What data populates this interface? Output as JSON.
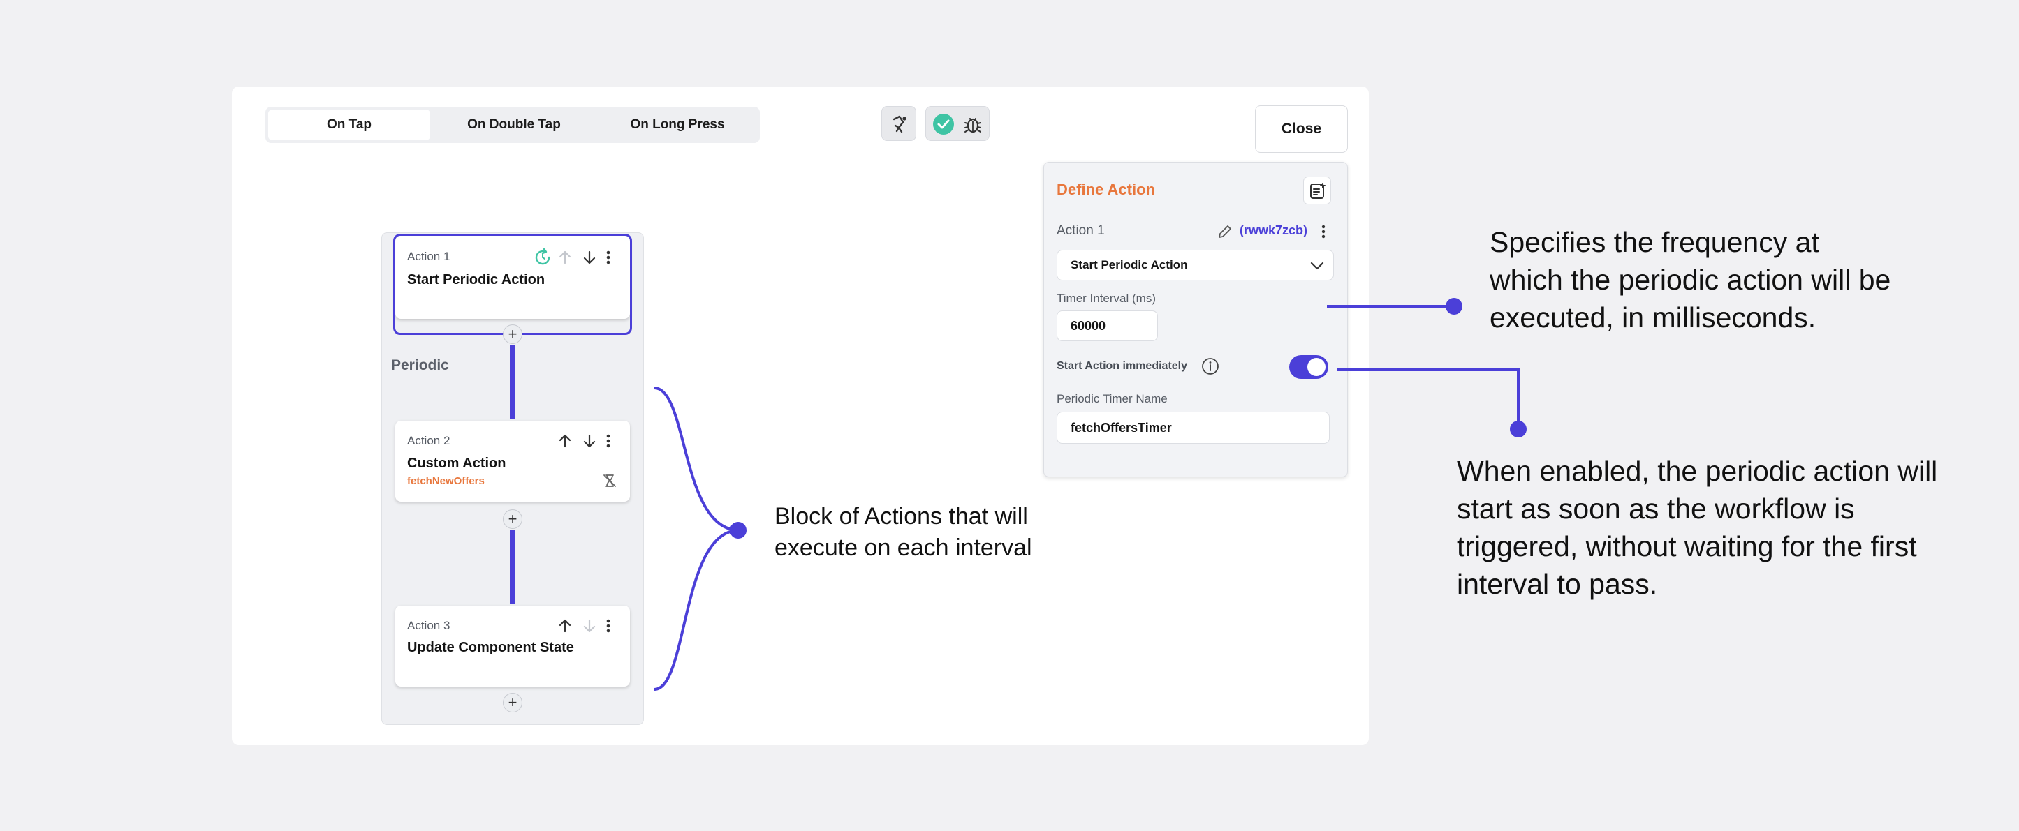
{
  "tabs": [
    "On Tap",
    "On Double Tap",
    "On Long Press"
  ],
  "close_label": "Close",
  "actions": [
    {
      "label": "Action 1",
      "title": "Start Periodic Action"
    },
    {
      "label": "Action 2",
      "title": "Custom Action",
      "subtitle": "fetchNewOffers"
    },
    {
      "label": "Action 3",
      "title": "Update Component State"
    }
  ],
  "periodic_label": "Periodic",
  "define": {
    "title": "Define Action",
    "action_label": "Action 1",
    "action_id": "(rwwk7zcb)",
    "selected_action": "Start Periodic Action",
    "timer_interval_label": "Timer Interval (ms)",
    "timer_interval_value": "60000",
    "start_immediately_label": "Start Action immediately",
    "start_immediately_on": true,
    "timer_name_label": "Periodic Timer Name",
    "timer_name_value": "fetchOffersTimer"
  },
  "annotations": {
    "block": "Block of Actions that will execute on each interval",
    "frequency": "Specifies the frequency at which the periodic action will be executed, in milliseconds.",
    "immediate": "When enabled, the periodic action will start as soon as the workflow is triggered, without waiting for the first interval to pass."
  },
  "colors": {
    "accent": "#4b3fd8",
    "orange": "#e8773d",
    "green": "#3fc4a4"
  }
}
